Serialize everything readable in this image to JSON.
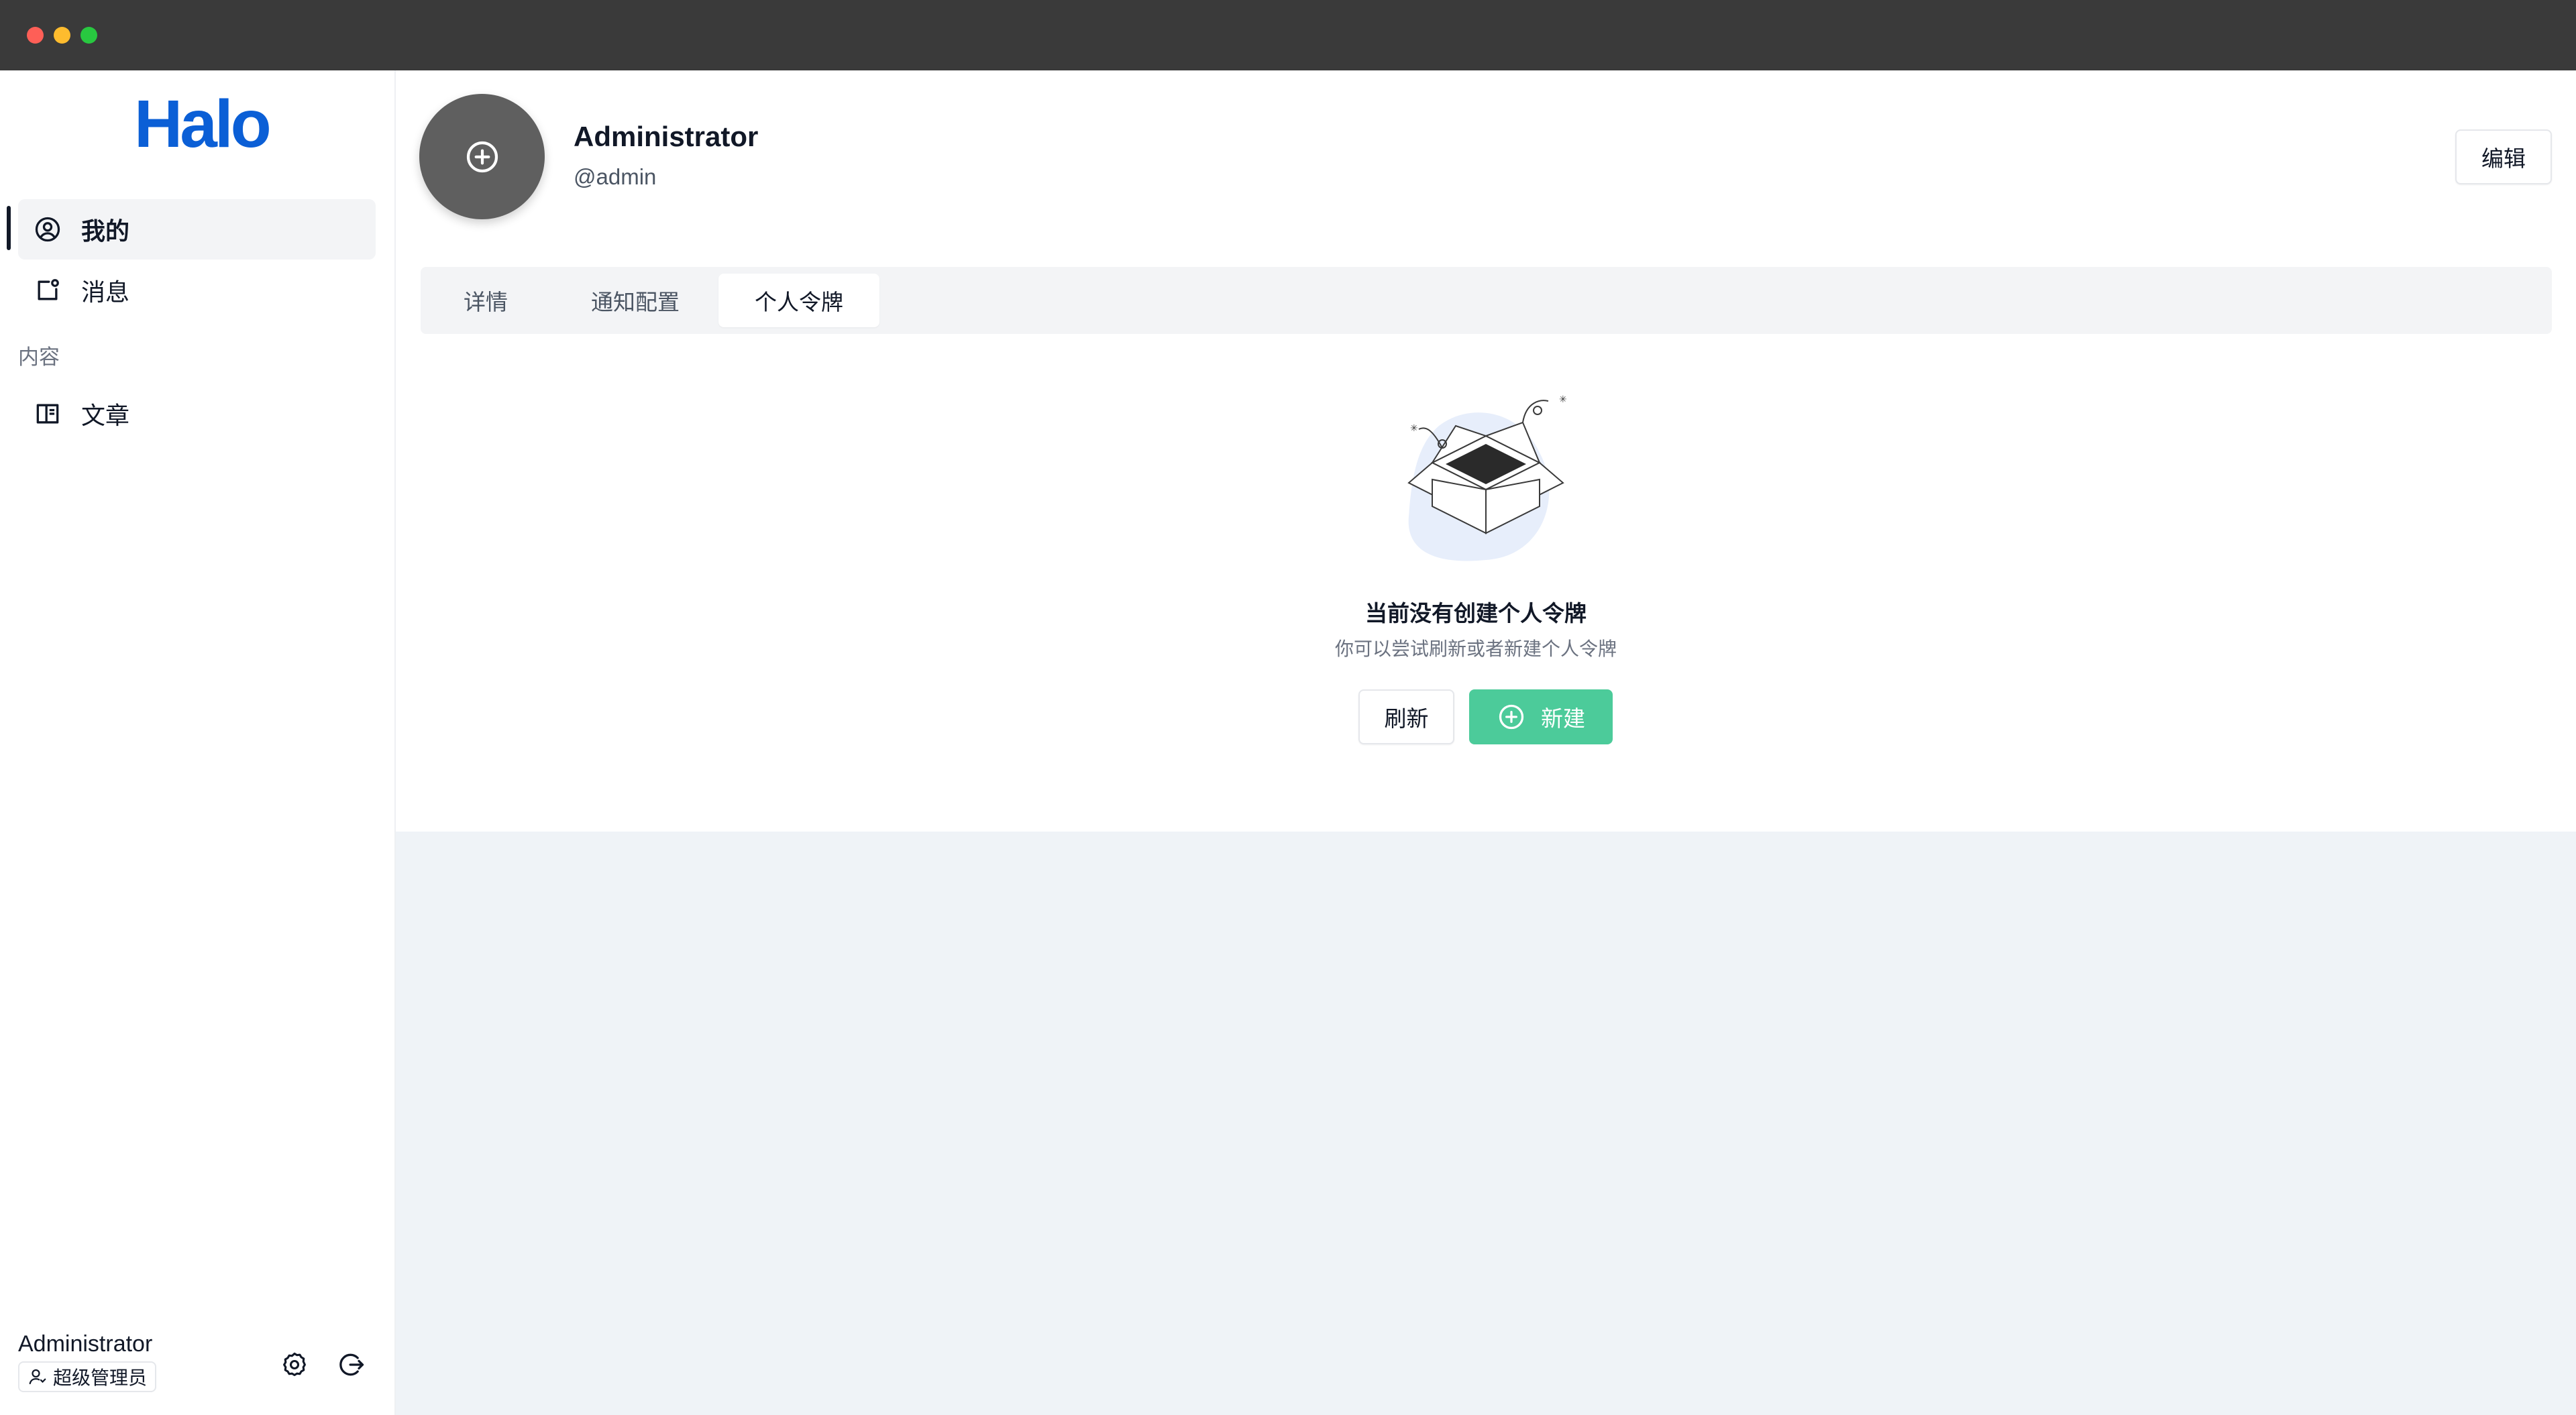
{
  "app": {
    "logo_text": "Halo"
  },
  "sidebar": {
    "items": [
      {
        "label": "我的",
        "icon": "user-circle-icon",
        "active": true
      },
      {
        "label": "消息",
        "icon": "notification-icon",
        "active": false
      }
    ],
    "group_label": "内容",
    "group_items": [
      {
        "label": "文章",
        "icon": "book-icon",
        "active": false
      }
    ],
    "footer": {
      "user_name": "Administrator",
      "role": "超级管理员",
      "settings_icon": "gear-icon",
      "logout_icon": "logout-icon"
    }
  },
  "profile": {
    "name": "Administrator",
    "handle": "@admin",
    "edit_label": "编辑"
  },
  "tabs": [
    {
      "label": "详情",
      "active": false
    },
    {
      "label": "通知配置",
      "active": false
    },
    {
      "label": "个人令牌",
      "active": true
    }
  ],
  "empty_state": {
    "title": "当前没有创建个人令牌",
    "description": "你可以尝试刷新或者新建个人令牌",
    "refresh_label": "刷新",
    "new_label": "新建"
  },
  "colors": {
    "brand": "#0b5fd6",
    "primary_button": "#4ccb9a",
    "main_background": "#eff3f7"
  }
}
